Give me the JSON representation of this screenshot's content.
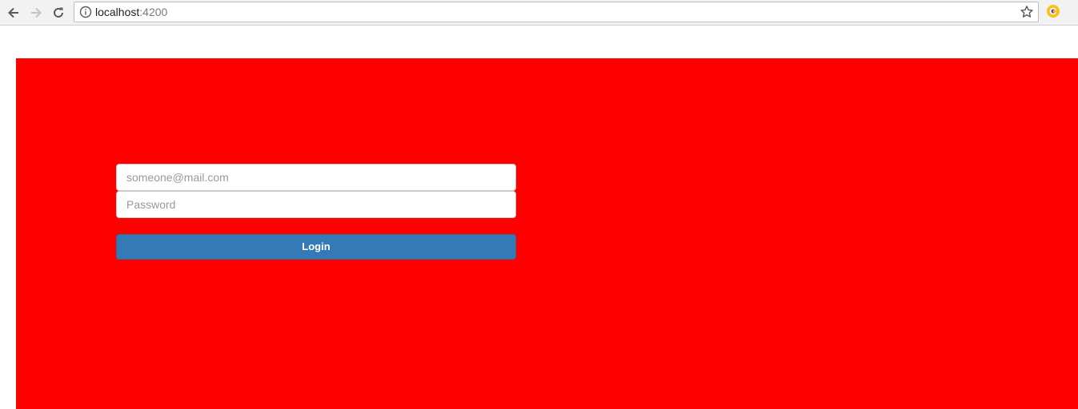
{
  "browser": {
    "url_host": "localhost",
    "url_port": ":4200",
    "icons": {
      "back": "arrow-left-icon",
      "forward": "arrow-right-icon",
      "reload": "reload-icon",
      "info": "info-icon",
      "bookmark": "star-icon",
      "extension": "extension-icon"
    }
  },
  "page": {
    "panel_color": "#ff0000",
    "form": {
      "email_placeholder": "someone@mail.com",
      "email_value": "",
      "password_placeholder": "Password",
      "password_value": "",
      "login_label": "Login",
      "button_color": "#337ab7"
    }
  }
}
